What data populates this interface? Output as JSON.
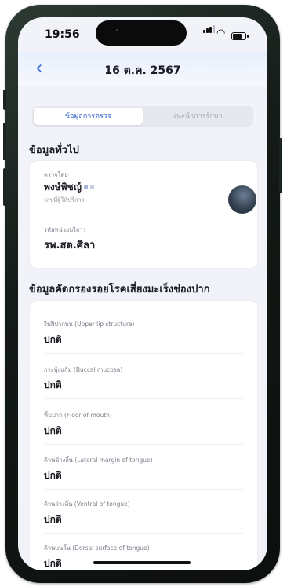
{
  "status_bar": {
    "time": "19:56"
  },
  "nav": {
    "back_icon": "chevron-left-icon",
    "title": "16 ต.ค. 2567"
  },
  "tabs": [
    {
      "label": "ข้อมูลการตรวจ",
      "active": true
    },
    {
      "label": "แนะนำการรักษา",
      "active": false
    }
  ],
  "general": {
    "section_title": "ข้อมูลทั่วไป",
    "examiner_label": "ตรวจโดย",
    "examiner_name": "พงษ์พิชญ์",
    "service_no_label": "เลขที่ผู้ให้บริการ -",
    "unit_label": "รหัสหน่วยบริการ",
    "unit_value": "รพ.สต.ศิลา"
  },
  "screening": {
    "section_title": "ข้อมูลคัดกรองรอยโรคเสี่ยงมะเร็งช่องปาก",
    "items": [
      {
        "label": "ริมฝีปากบน (Upper lip structure)",
        "value": "ปกติ"
      },
      {
        "label": "กระพุ้งแก้ม (Buccal mucosa)",
        "value": "ปกติ"
      },
      {
        "label": "พื้นปาก (Floor of mouth)",
        "value": "ปกติ"
      },
      {
        "label": "ด้านข้างลิ้น (Lateral margin of tongue)",
        "value": "ปกติ"
      },
      {
        "label": "ด้านล่างลิ้น (Ventral of tongue)",
        "value": "ปกติ"
      },
      {
        "label": "ด้านบนลิ้น (Dorsal surface of tongue)",
        "value": "ปกติ"
      }
    ]
  },
  "colors": {
    "accent": "#3a68d8",
    "background": "#f1f3f8",
    "frame": "#141a17"
  }
}
